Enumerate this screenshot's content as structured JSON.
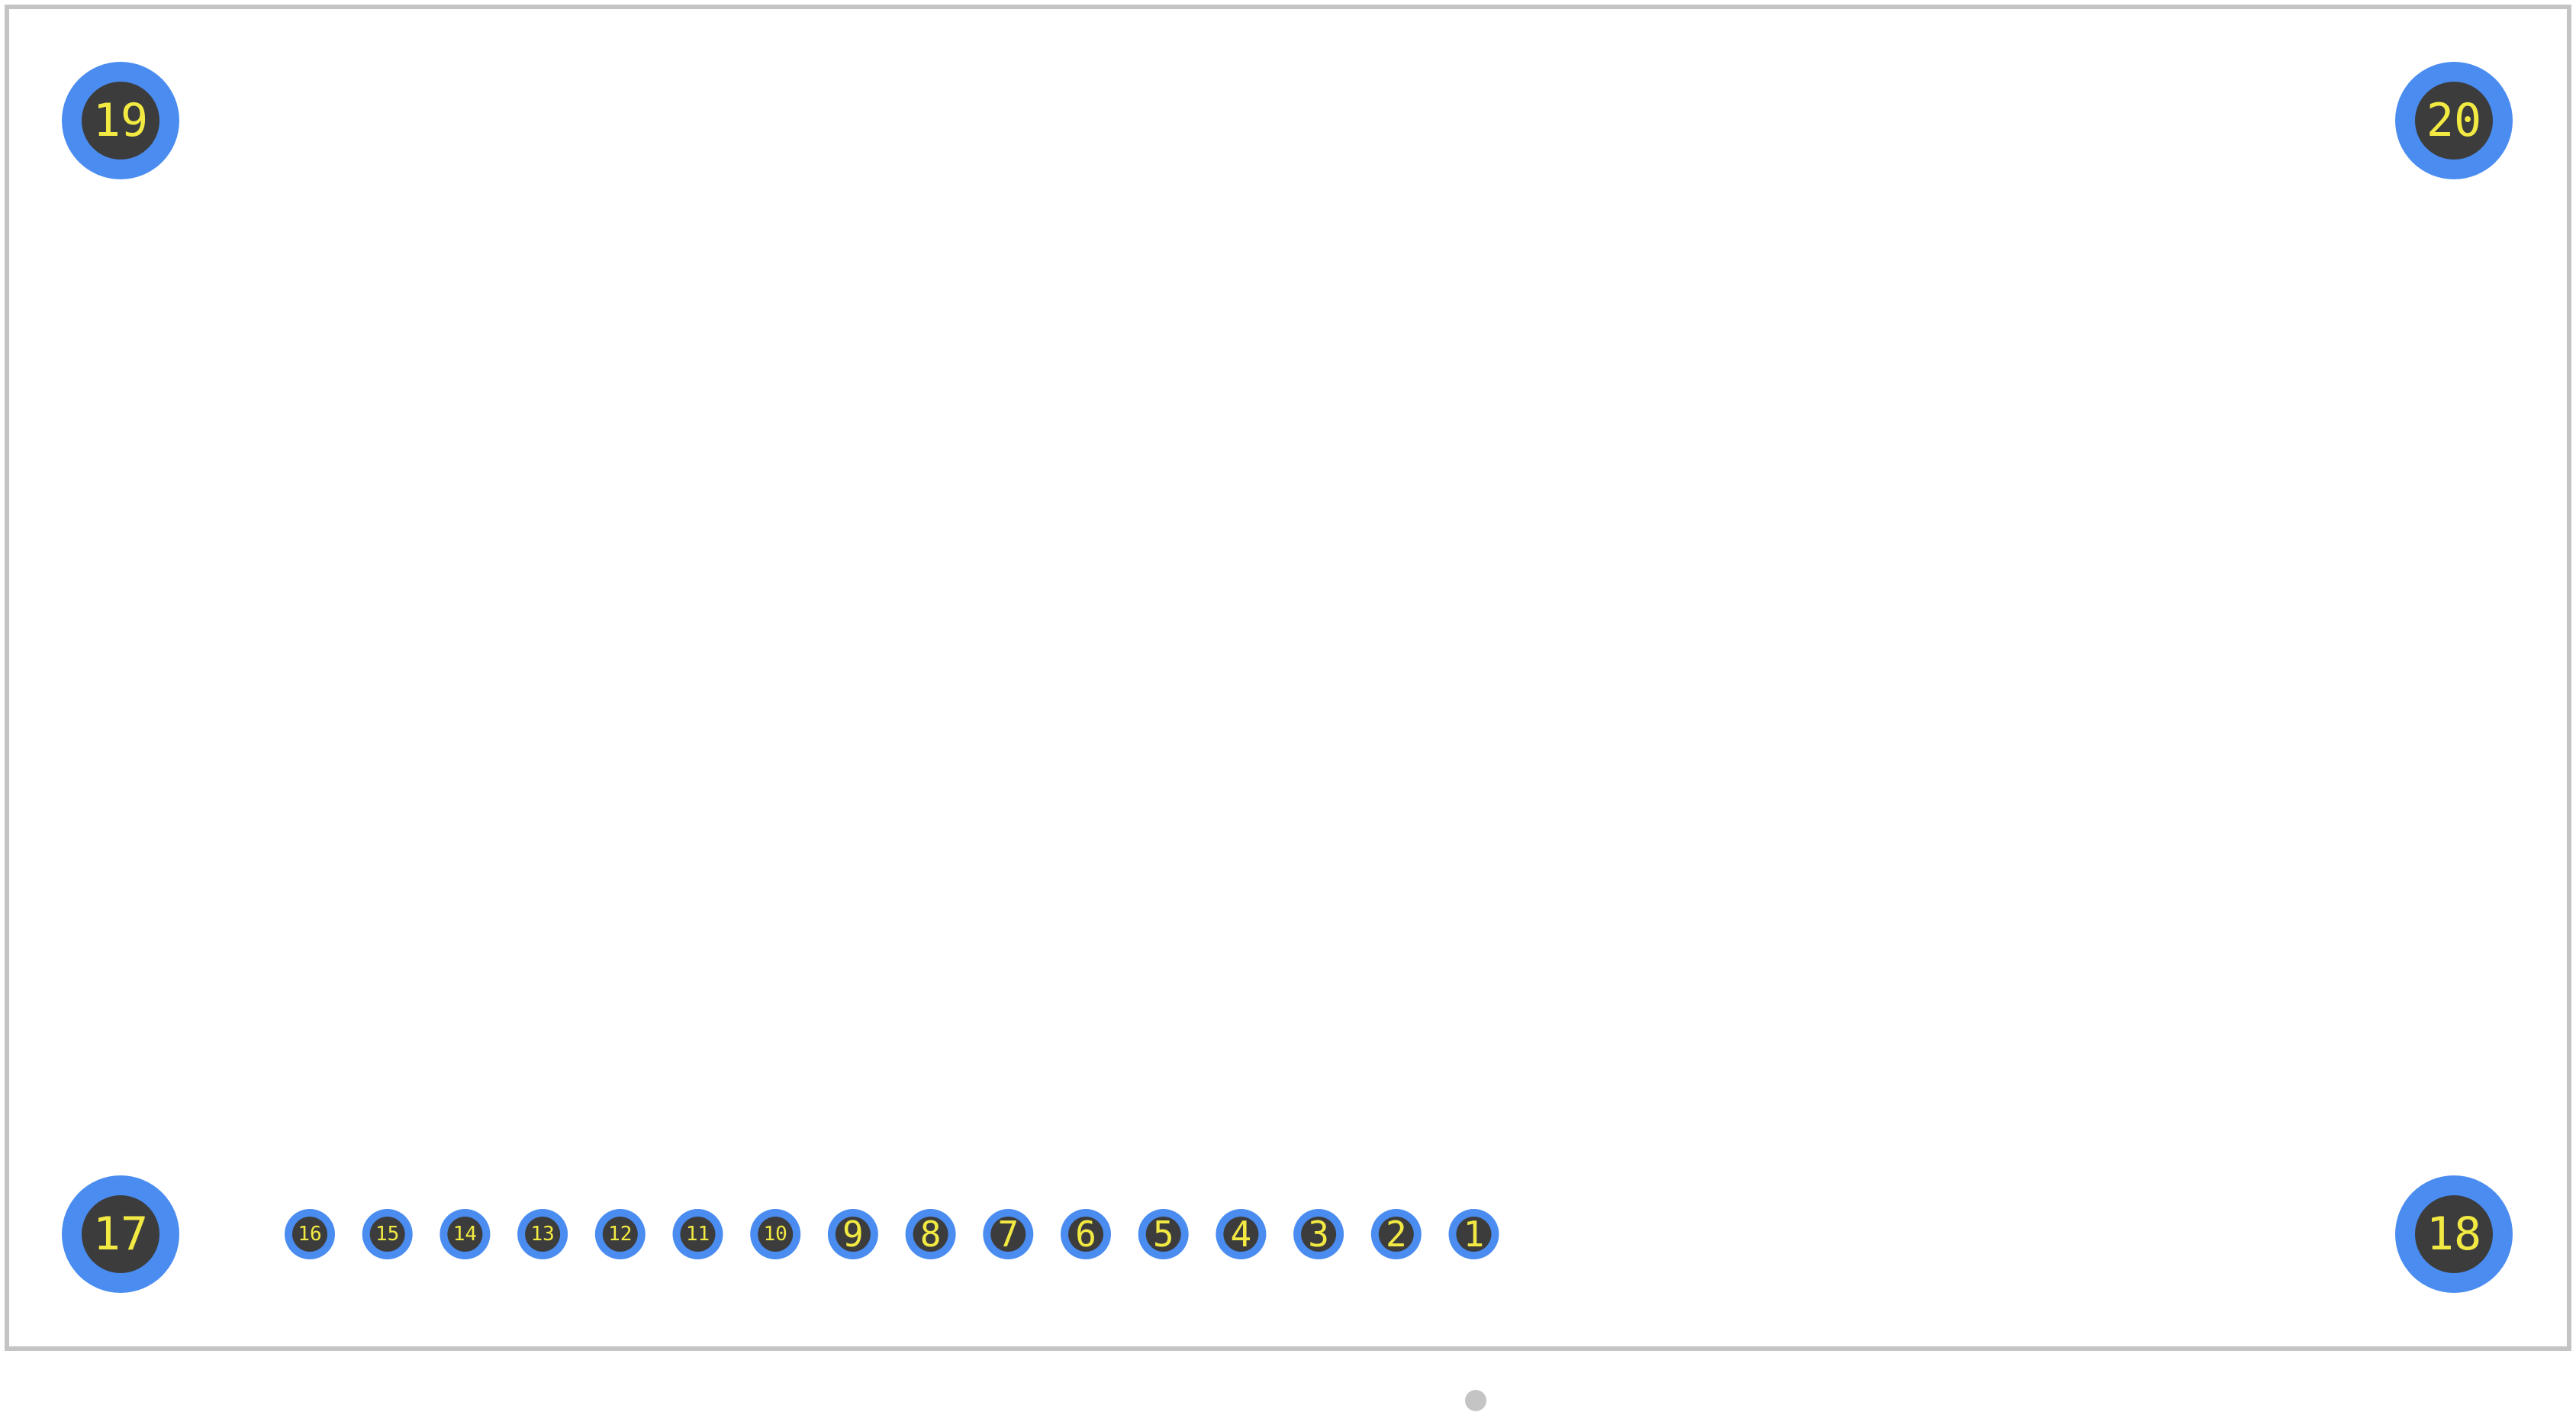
{
  "footprint": {
    "outline_color": "#c4c4c4",
    "pad_ring_color": "#4a8cf0",
    "pad_hole_color": "#3c3c3c",
    "label_color": "#f2ea42",
    "origin_marker_color": "#c4c4c4"
  },
  "mounting_pads": [
    {
      "label": "19"
    },
    {
      "label": "20"
    },
    {
      "label": "17"
    },
    {
      "label": "18"
    }
  ],
  "signal_pads": [
    {
      "label": "16"
    },
    {
      "label": "15"
    },
    {
      "label": "14"
    },
    {
      "label": "13"
    },
    {
      "label": "12"
    },
    {
      "label": "11"
    },
    {
      "label": "10"
    },
    {
      "label": "9"
    },
    {
      "label": "8"
    },
    {
      "label": "7"
    },
    {
      "label": "6"
    },
    {
      "label": "5"
    },
    {
      "label": "4"
    },
    {
      "label": "3"
    },
    {
      "label": "2"
    },
    {
      "label": "1"
    }
  ]
}
